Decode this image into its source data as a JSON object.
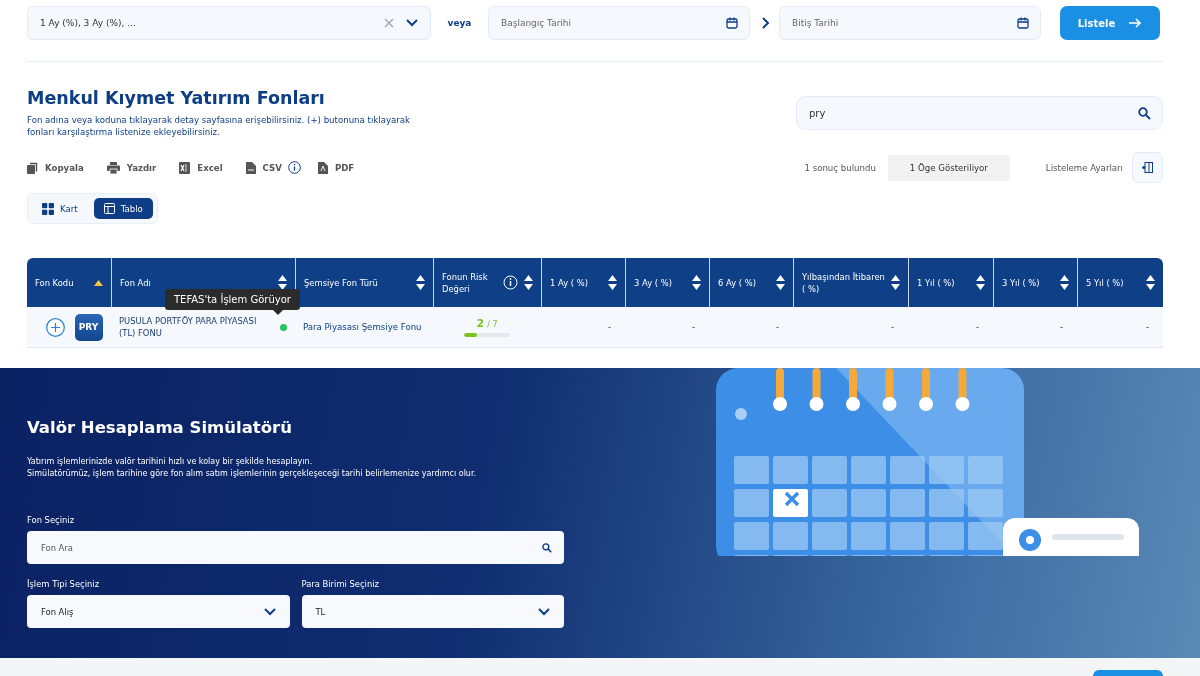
{
  "filter_bar": {
    "period_select": {
      "value": "1 Ay (%), 3 Ay (%), ..."
    },
    "or_label": "veya",
    "start_date": {
      "placeholder": "Başlangıç Tarihi"
    },
    "end_date": {
      "placeholder": "Bitiş Tarihi"
    },
    "list_button": "Listele"
  },
  "funds": {
    "title": "Menkul Kıymet Yatırım Fonları",
    "description": "Fon adına veya koduna tıklayarak detay sayfasına erişebilirsiniz. (+) butonuna tıklayarak fonları karşılaştırma listenize ekleyebilirsiniz.",
    "search": {
      "value": "pry"
    },
    "export_actions": [
      {
        "kind": "copy",
        "label": "Kopyala"
      },
      {
        "kind": "print",
        "label": "Yazdır"
      },
      {
        "kind": "excel",
        "label": "Excel"
      },
      {
        "kind": "csv",
        "label": "CSV",
        "info": true
      },
      {
        "kind": "pdf",
        "label": "PDF"
      }
    ],
    "result_count": "1 sonuç bulundu",
    "shown_count": "1 Öge Gösteriliyor",
    "list_settings": "Listeleme Ayarları",
    "view_toggle": [
      {
        "kind": "card",
        "label": "Kart",
        "selected": false
      },
      {
        "kind": "table",
        "label": "Tablo",
        "selected": true
      }
    ],
    "table": {
      "columns": [
        {
          "label": "Fon Kodu",
          "sorted": true
        },
        {
          "label": "Fon Adı",
          "sorted": false
        },
        {
          "label": "Şemsiye Fon Türü",
          "sorted": false
        },
        {
          "label": "Fonun Risk Değeri",
          "sorted": false,
          "info": true
        },
        {
          "label": "1 Ay ( %)",
          "sorted": false
        },
        {
          "label": "3 Ay ( %)",
          "sorted": false
        },
        {
          "label": "6 Ay ( %)",
          "sorted": false
        },
        {
          "label": "Yılbaşından İtibaren ( %)",
          "sorted": false
        },
        {
          "label": "1 Yıl ( %)",
          "sorted": false
        },
        {
          "label": "3 Yıl ( %)",
          "sorted": false
        },
        {
          "label": "5 Yıl ( %)",
          "sorted": false
        }
      ],
      "rows": [
        {
          "code": "PRY",
          "name": "PUSULA PORTFÖY PARA PİYASASI (TL) FONU",
          "tefas_active": true,
          "umbrella_type": "Para Piyasası Şemsiye Fonu",
          "risk": "2",
          "risk_max": "/ 7",
          "level": 0.286,
          "returns": [
            "-",
            "-",
            "-",
            "-",
            "-",
            "-",
            "-"
          ]
        }
      ]
    },
    "tooltip": "TEFAS'ta İşlem Görüyor"
  },
  "simulator": {
    "title": "Valör Hesaplama Simülatörü",
    "description": [
      "Yatırım işlemlerinizde valör tarihini hızlı ve kolay bir şekilde hesaplayın.",
      "Simülatörümüz, işlem tarihine göre fon alım satım işlemlerinin gerçekleşeceği tarihi belirlemenize yardımcı olur."
    ],
    "fund_label": "Fon Seçiniz",
    "fund_search": {
      "placeholder": "Fon Ara"
    },
    "type_label": "İşlem Tipi Seçiniz",
    "type_select": {
      "value": "Fon Alış"
    },
    "currency_label": "Para Birimi Seçiniz",
    "currency_select": {
      "value": "TL"
    }
  }
}
